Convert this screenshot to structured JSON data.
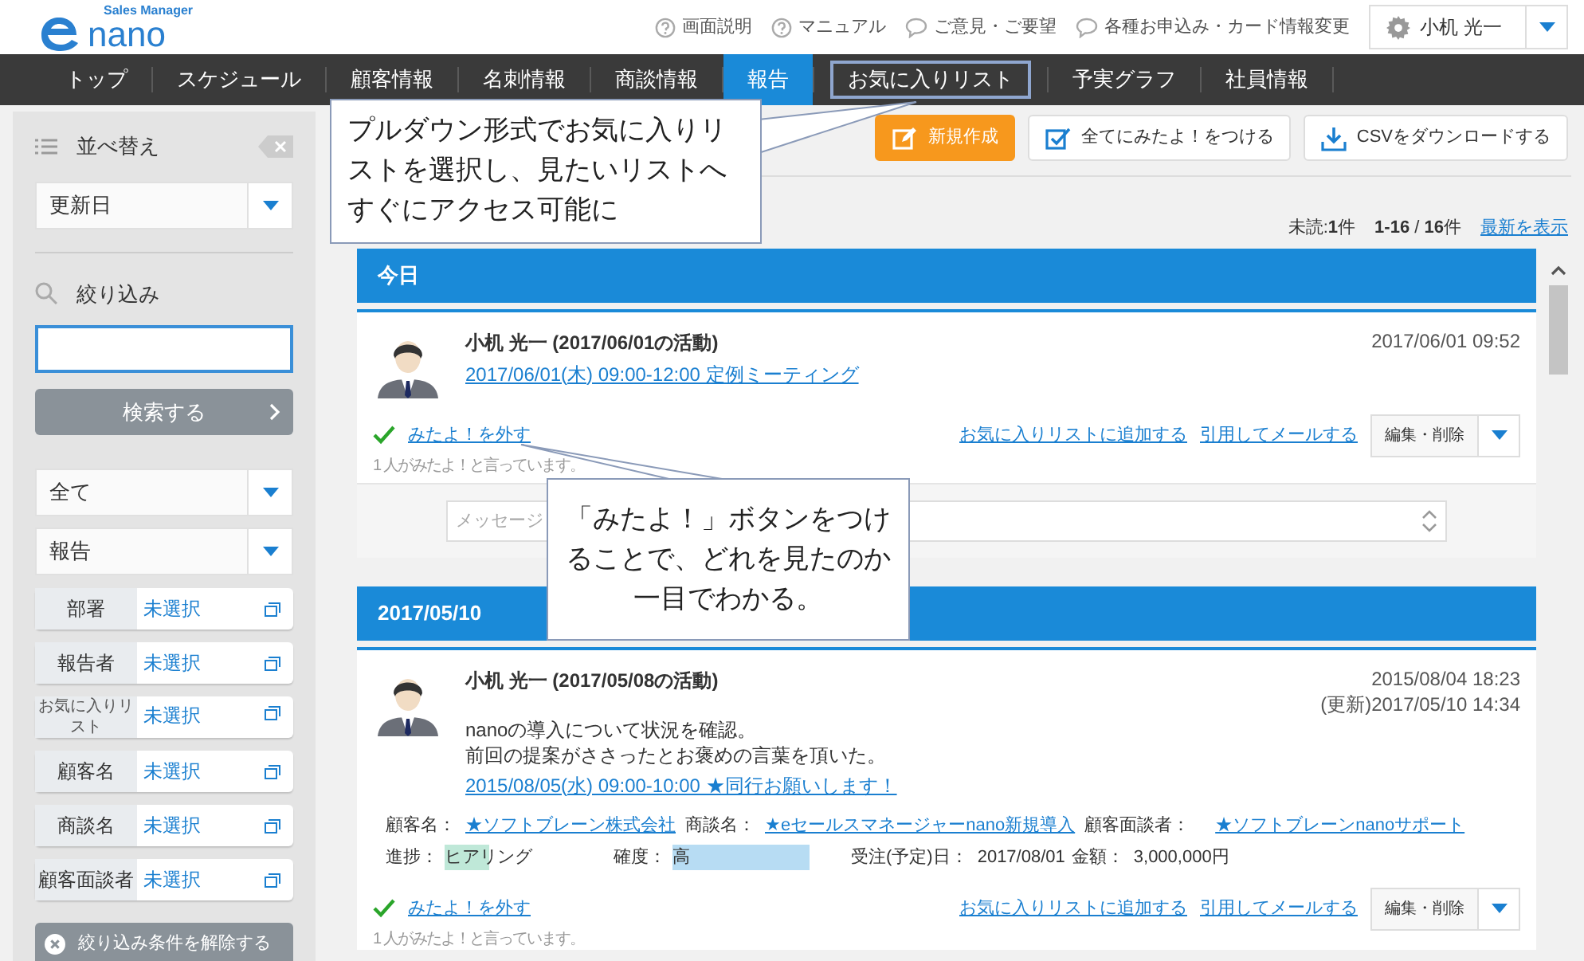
{
  "header": {
    "logo_tagline": "Sales Manager",
    "logo_name": "nano",
    "links": [
      {
        "kind": "help",
        "label": "画面説明"
      },
      {
        "kind": "help",
        "label": "マニュアル"
      },
      {
        "kind": "comment",
        "label": "ご意見・ご要望"
      },
      {
        "kind": "comment",
        "label": "各種お申込み・カード情報変更"
      }
    ],
    "user": "小机 光一"
  },
  "nav": [
    {
      "label": "トップ",
      "selected": false,
      "outlined": false
    },
    {
      "label": "スケジュール",
      "selected": false,
      "outlined": false
    },
    {
      "label": "顧客情報",
      "selected": false,
      "outlined": false
    },
    {
      "label": "名刺情報",
      "selected": false,
      "outlined": false
    },
    {
      "label": "商談情報",
      "selected": false,
      "outlined": false
    },
    {
      "label": "報告",
      "selected": true,
      "outlined": false
    },
    {
      "label": "お気に入りリスト",
      "selected": false,
      "outlined": true
    },
    {
      "label": "予実グラフ",
      "selected": false,
      "outlined": false
    },
    {
      "label": "社員情報",
      "selected": false,
      "outlined": false
    }
  ],
  "sidebar": {
    "sort_label": "並べ替え",
    "sort_value": "更新日",
    "filter_label": "絞り込み",
    "search_button": "検索する",
    "selects": [
      "全て",
      "報告"
    ],
    "fields": [
      {
        "label": "部署",
        "value": "未選択",
        "small": false
      },
      {
        "label": "報告者",
        "value": "未選択",
        "small": false
      },
      {
        "label": "お気に入りリスト",
        "value": "未選択",
        "small": true
      },
      {
        "label": "顧客名",
        "value": "未選択",
        "small": false
      },
      {
        "label": "商談名",
        "value": "未選択",
        "small": false
      },
      {
        "label": "顧客面談者",
        "value": "未選択",
        "small": false
      }
    ],
    "clear_button": "絞り込み条件を解除する"
  },
  "toolbar": [
    {
      "kind": "new",
      "label": "新規作成"
    },
    {
      "kind": "check",
      "label": "全てにみたよ！をつける"
    },
    {
      "kind": "download",
      "label": "CSVをダウンロードする"
    }
  ],
  "summary": {
    "unread": "未読:**1**件",
    "range": "**1-16** / **16**件",
    "latest_link": "最新を表示"
  },
  "groups": [
    {
      "date": "今日",
      "entries": [
        {
          "title": "小机 光一 (2017/06/01の活動)",
          "timestamps": [
            "2017/06/01 09:52"
          ],
          "link": "2017/06/01(木) 09:00-12:00 定例ミーティング",
          "seen_label": "みたよ！を外す",
          "seen": true,
          "seen_note": "1 人がみたよ！と言っています。",
          "actions": [
            "お気に入りリストに追加する",
            "引用してメールする"
          ],
          "edit_button": "編集・削除",
          "message_placeholder": "メッセージ"
        }
      ]
    },
    {
      "date": "2017/05/10",
      "entries": [
        {
          "title": "小机 光一 (2017/05/08の活動)",
          "timestamps": [
            "2015/08/04 18:23",
            "(更新)2017/05/10 14:34"
          ],
          "body": [
            "nanoの導入について状況を確認。",
            "前回の提案がささったとお褒めの言葉を頂いた。"
          ],
          "link": "2015/08/05(水) 09:00-10:00 ★同行お願いします！",
          "details": {
            "customer_label": "顧客名：",
            "customer": "★ソフトブレーン株式会社",
            "deal_label": "商談名：",
            "deal": "★eセールスマネージャーnano新規導入",
            "contact_label": "顧客面談者：",
            "contact": "★ソフトブレーンnanoサポート",
            "progress": {
              "label": "進捗：",
              "value": "ヒアリング"
            },
            "certainty": {
              "label": "確度：",
              "value": "高"
            },
            "order_label": "受注(予定)日：",
            "order_date": "2017/08/01",
            "amount_label": "金額：",
            "amount": "3,000,000円"
          },
          "seen_label": "みたよ！を外す",
          "seen": true,
          "seen_note": "1 人がみたよ！と言っています。",
          "actions": [
            "お気に入りリストに追加する",
            "引用してメールする"
          ],
          "edit_button": "編集・削除"
        }
      ]
    }
  ],
  "callouts": [
    {
      "text": "プルダウン形式でお気に入りリストを選択し、見たいリストへすぐにアクセス可能に"
    },
    {
      "text": "「みたよ！」ボタンをつけることで、どれを見たのか一目でわかる。"
    }
  ]
}
